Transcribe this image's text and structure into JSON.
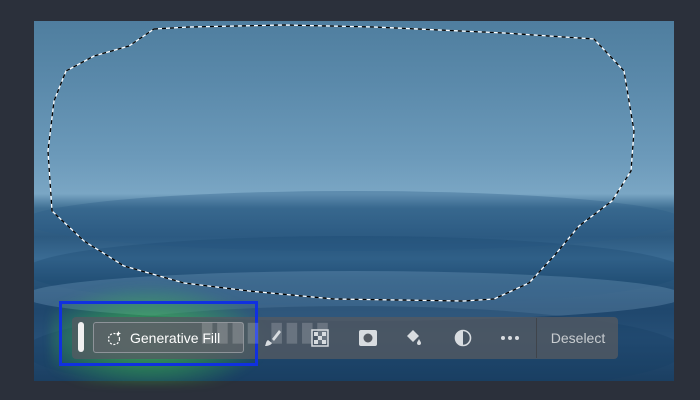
{
  "toolbar": {
    "generative_fill_label": "Generative Fill",
    "deselect_label": "Deselect"
  },
  "icons": {
    "generative_fill": "sparkle-icon",
    "tools": [
      "brush-icon",
      "transparency-checker-icon",
      "mask-icon",
      "paint-bucket-icon",
      "adjustment-icon",
      "more-icon"
    ]
  },
  "colors": {
    "app_background": "#2b303b",
    "toolbar_background": "#545a62",
    "highlight_box": "#1030e0",
    "glow": "#5aff50"
  }
}
